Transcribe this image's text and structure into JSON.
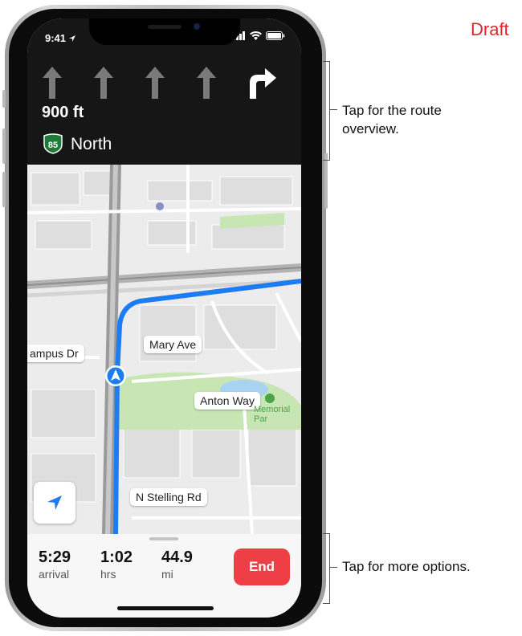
{
  "draft_label": "Draft",
  "status_bar": {
    "time": "9:41"
  },
  "guidance": {
    "lane_icons": [
      "up-arrow-icon",
      "up-arrow-icon",
      "up-arrow-icon",
      "up-arrow-icon",
      "turn-right-icon"
    ],
    "distance": "900 ft",
    "route_shield": "85",
    "road_direction": "North"
  },
  "map": {
    "labels": {
      "mary_ave": "Mary Ave",
      "campus_dr": "ampus Dr",
      "anton_way": "Anton Way",
      "memorial_park": "Memorial Par",
      "n_stelling": "N Stelling Rd"
    }
  },
  "trip": {
    "arrival_value": "5:29",
    "arrival_label": "arrival",
    "hrs_value": "1:02",
    "hrs_label": "hrs",
    "miles_value": "44.9",
    "miles_label": "mi",
    "end_button": "End"
  },
  "callouts": {
    "top": "Tap for the route overview.",
    "bottom": "Tap for more options."
  },
  "colors": {
    "route": "#1e7cf2",
    "end_button": "#ee3f46",
    "draft": "#e8222a",
    "park": "#c8e6b4"
  }
}
